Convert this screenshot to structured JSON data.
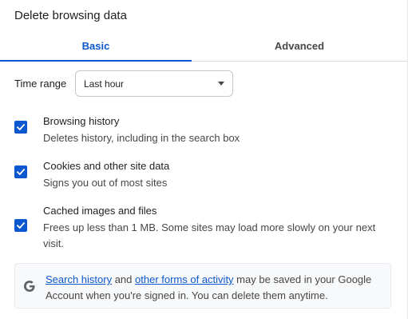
{
  "dialog": {
    "title": "Delete browsing data"
  },
  "tabs": [
    {
      "label": "Basic",
      "selected": true
    },
    {
      "label": "Advanced",
      "selected": false
    }
  ],
  "time_range": {
    "label": "Time range",
    "value": "Last hour"
  },
  "options": [
    {
      "title": "Browsing history",
      "description": "Deletes history, including in the search box",
      "checked": true
    },
    {
      "title": "Cookies and other site data",
      "description": "Signs you out of most sites",
      "checked": true
    },
    {
      "title": "Cached images and files",
      "description": "Frees up less than 1 MB. Some sites may load more slowly on your next visit.",
      "checked": true
    }
  ],
  "info": {
    "icon": "google-g-icon",
    "link1": "Search history",
    "text1": " and ",
    "link2": "other forms of activity",
    "text2": " may be saved in your Google Account when you're signed in. You can delete them anytime."
  },
  "colors": {
    "accent": "#0b57d0",
    "text": "#1f1f1f",
    "secondary_text": "#474747"
  }
}
